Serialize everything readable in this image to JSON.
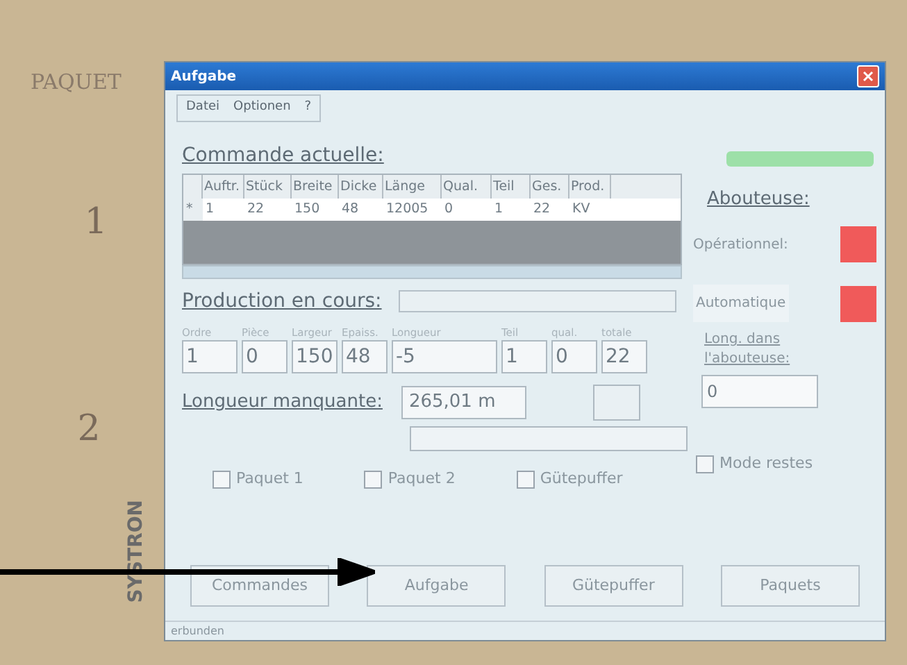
{
  "bezel": {
    "handwritten_labels": [
      "PAQUET",
      "1",
      "2"
    ],
    "brand": "SYSTRON"
  },
  "window": {
    "title": "Aufgabe"
  },
  "menu": [
    "Datei",
    "Optionen",
    "?"
  ],
  "current_order": {
    "heading": "Commande actuelle:",
    "columns": [
      "",
      "Auftr.",
      "Stück",
      "Breite",
      "Dicke",
      "Länge",
      "Qual.",
      "Teil",
      "Ges.",
      "Prod."
    ],
    "rows": [
      [
        "*",
        "1",
        "22",
        "150",
        "48",
        "12005",
        "0",
        "1",
        "22",
        "KV"
      ]
    ]
  },
  "production": {
    "heading": "Production en cours:",
    "field_labels": [
      "Ordre",
      "Pièce",
      "Largeur",
      "Epaiss.",
      "Longueur",
      "Teil",
      "qual.",
      "totale"
    ],
    "field_values": [
      "1",
      "0",
      "150",
      "48",
      "-5",
      "1",
      "0",
      "22"
    ]
  },
  "missing_length": {
    "label": "Longueur manquante:",
    "value": "265,01 m"
  },
  "checkboxes": [
    {
      "label": "Paquet 1",
      "checked": false
    },
    {
      "label": "Paquet 2",
      "checked": false
    },
    {
      "label": "Gütepuffer",
      "checked": false
    }
  ],
  "side": {
    "heading": "Abouteuse:",
    "indicators": [
      {
        "label": "Opérationnel:",
        "color": "#f05a5a"
      },
      {
        "label": "Automatique",
        "color": "#f05a5a"
      }
    ],
    "length_label": "Long. dans l'abouteuse:",
    "length_value": "0",
    "rest_mode": {
      "label": "Mode restes",
      "checked": false
    }
  },
  "buttons": [
    "Commandes",
    "Aufgabe",
    "Gütepuffer",
    "Paquets"
  ],
  "status_bar": "erbunden"
}
